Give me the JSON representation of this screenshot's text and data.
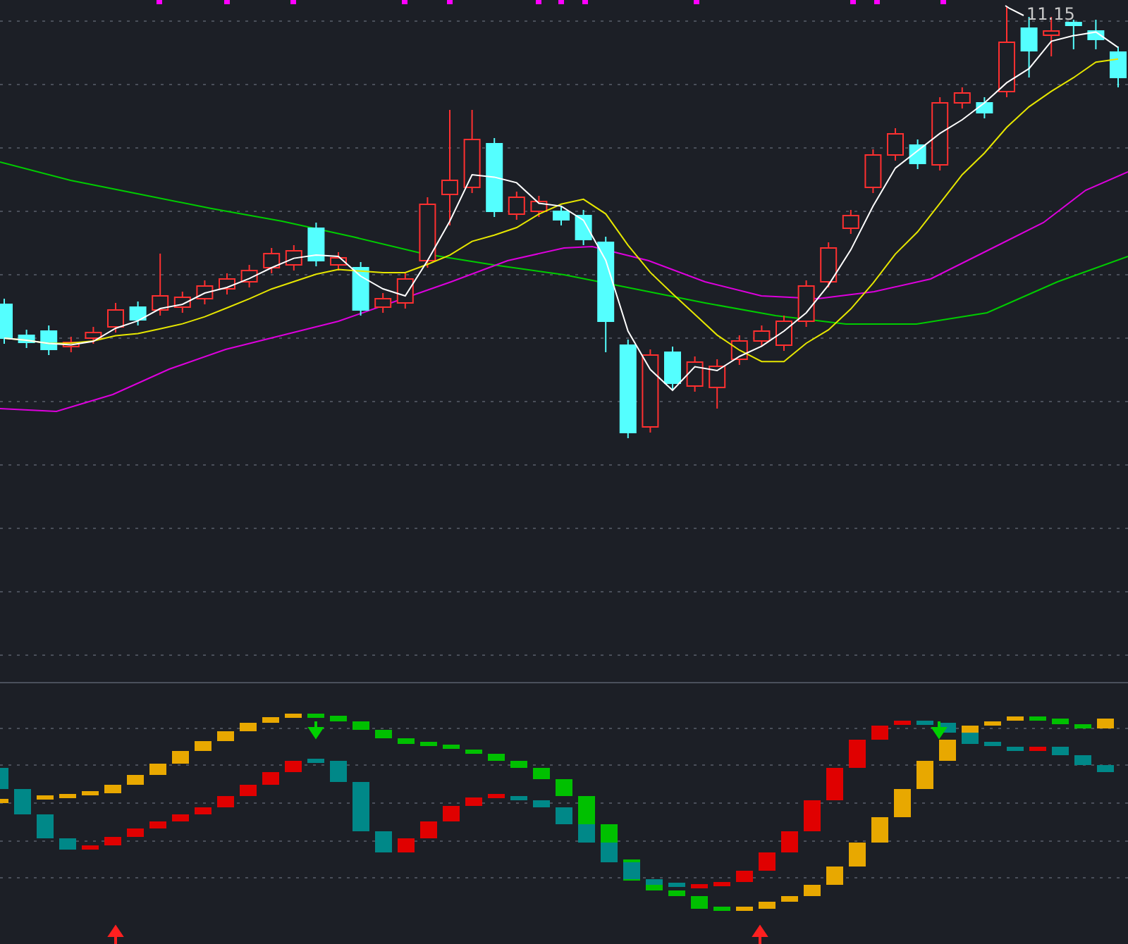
{
  "price_chart": {
    "high_label": "11.15"
  }
}
